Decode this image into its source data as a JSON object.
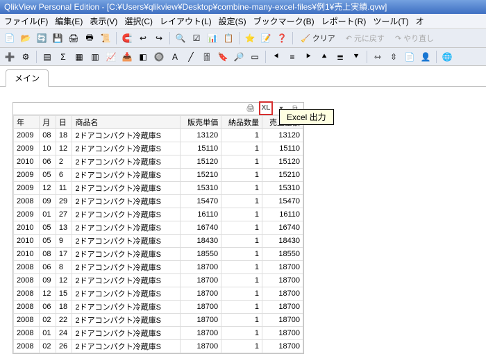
{
  "title": "QlikView Personal Edition - [C:¥Users¥qlikview¥Desktop¥combine-many-excel-files¥例1¥売上実績.qvw]",
  "menu": {
    "file": "ファイル(F)",
    "edit": "編集(E)",
    "view": "表示(V)",
    "select": "選択(C)",
    "layout": "レイアウト(L)",
    "setting": "設定(S)",
    "bookmark": "ブックマーク(B)",
    "report": "レポート(R)",
    "tool": "ツール(T)",
    "opt": "オ"
  },
  "toolbar1": {
    "clear": "クリア",
    "undo": "元に戻す",
    "redo": "やり直し"
  },
  "sheet_tab": "メイン",
  "tablebar_icons": {
    "print": "print-icon",
    "excel": "XL",
    "dropdown": "▾",
    "close": "⧉"
  },
  "tooltip": "Excel 出力",
  "columns": {
    "year": "年",
    "month": "月",
    "day": "日",
    "product": "商品名",
    "unit_price": "販売単価",
    "qty": "納品数量",
    "amount": "売上金額"
  },
  "rows": [
    {
      "year": "2009",
      "month": "08",
      "day": "18",
      "product": "2ドアコンパクト冷蔵庫S",
      "unit_price": "13120",
      "qty": "1",
      "amount": "13120"
    },
    {
      "year": "2009",
      "month": "10",
      "day": "12",
      "product": "2ドアコンパクト冷蔵庫S",
      "unit_price": "15110",
      "qty": "1",
      "amount": "15110"
    },
    {
      "year": "2010",
      "month": "06",
      "day": "2",
      "product": "2ドアコンパクト冷蔵庫S",
      "unit_price": "15120",
      "qty": "1",
      "amount": "15120"
    },
    {
      "year": "2009",
      "month": "05",
      "day": "6",
      "product": "2ドアコンパクト冷蔵庫S",
      "unit_price": "15210",
      "qty": "1",
      "amount": "15210"
    },
    {
      "year": "2009",
      "month": "12",
      "day": "11",
      "product": "2ドアコンパクト冷蔵庫S",
      "unit_price": "15310",
      "qty": "1",
      "amount": "15310"
    },
    {
      "year": "2008",
      "month": "09",
      "day": "29",
      "product": "2ドアコンパクト冷蔵庫S",
      "unit_price": "15470",
      "qty": "1",
      "amount": "15470"
    },
    {
      "year": "2009",
      "month": "01",
      "day": "27",
      "product": "2ドアコンパクト冷蔵庫S",
      "unit_price": "16110",
      "qty": "1",
      "amount": "16110"
    },
    {
      "year": "2010",
      "month": "05",
      "day": "13",
      "product": "2ドアコンパクト冷蔵庫S",
      "unit_price": "16740",
      "qty": "1",
      "amount": "16740"
    },
    {
      "year": "2010",
      "month": "05",
      "day": "9",
      "product": "2ドアコンパクト冷蔵庫S",
      "unit_price": "18430",
      "qty": "1",
      "amount": "18430"
    },
    {
      "year": "2010",
      "month": "08",
      "day": "17",
      "product": "2ドアコンパクト冷蔵庫S",
      "unit_price": "18550",
      "qty": "1",
      "amount": "18550"
    },
    {
      "year": "2008",
      "month": "06",
      "day": "8",
      "product": "2ドアコンパクト冷蔵庫S",
      "unit_price": "18700",
      "qty": "1",
      "amount": "18700"
    },
    {
      "year": "2008",
      "month": "09",
      "day": "12",
      "product": "2ドアコンパクト冷蔵庫S",
      "unit_price": "18700",
      "qty": "1",
      "amount": "18700"
    },
    {
      "year": "2008",
      "month": "12",
      "day": "15",
      "product": "2ドアコンパクト冷蔵庫S",
      "unit_price": "18700",
      "qty": "1",
      "amount": "18700"
    },
    {
      "year": "2008",
      "month": "06",
      "day": "18",
      "product": "2ドアコンパクト冷蔵庫S",
      "unit_price": "18700",
      "qty": "1",
      "amount": "18700"
    },
    {
      "year": "2008",
      "month": "02",
      "day": "22",
      "product": "2ドアコンパクト冷蔵庫S",
      "unit_price": "18700",
      "qty": "1",
      "amount": "18700"
    },
    {
      "year": "2008",
      "month": "01",
      "day": "24",
      "product": "2ドアコンパクト冷蔵庫S",
      "unit_price": "18700",
      "qty": "1",
      "amount": "18700"
    },
    {
      "year": "2008",
      "month": "02",
      "day": "26",
      "product": "2ドアコンパクト冷蔵庫S",
      "unit_price": "18700",
      "qty": "1",
      "amount": "18700"
    }
  ]
}
